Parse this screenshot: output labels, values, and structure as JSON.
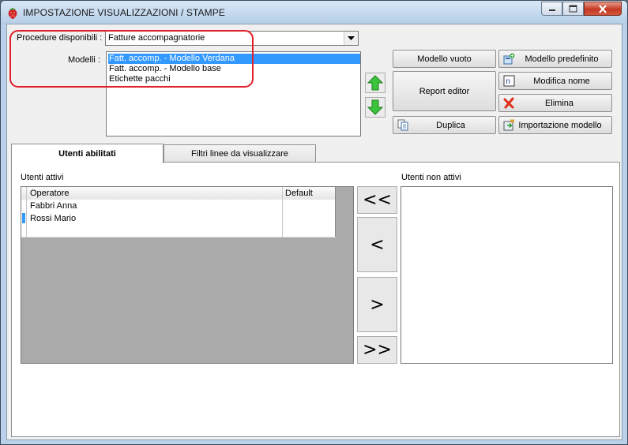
{
  "window": {
    "title": "IMPOSTAZIONE VISUALIZZAZIONI / STAMPE",
    "app_icon": "strawberry-icon",
    "controls": [
      "minimize",
      "maximize",
      "close"
    ]
  },
  "procedure": {
    "label": "Procedure disponibili :",
    "selected": "Fatture accompagnatorie"
  },
  "modelli": {
    "label": "Modelli :",
    "items": [
      {
        "label": "Fatt. accomp. - Modello Verdana",
        "selected": true
      },
      {
        "label": "Fatt. accomp. - Modello base",
        "selected": false
      },
      {
        "label": "Etichette pacchi",
        "selected": false
      }
    ]
  },
  "buttons": {
    "modello_vuoto": "Modello vuoto",
    "modello_predefinito": "Modello predefinito",
    "report_editor": "Report editor",
    "modifica_nome": "Modifica nome",
    "elimina": "Elimina",
    "duplica": "Duplica",
    "importazione_modello": "Importazione modello"
  },
  "tabs": [
    {
      "label": "Utenti abilitati",
      "active": true
    },
    {
      "label": "Filtri linee da visualizzare",
      "active": false
    }
  ],
  "utenti_attivi": {
    "label": "Utenti attivi",
    "columns": [
      "Operatore",
      "Default"
    ],
    "rows": [
      {
        "operatore": "Fabbri Anna",
        "default": ""
      },
      {
        "operatore": "Rossi Mario",
        "default": ""
      }
    ]
  },
  "utenti_non_attivi": {
    "label": "Utenti non attivi",
    "rows": []
  },
  "move_buttons": {
    "all_left": "<<",
    "one_left": "<",
    "one_right": ">",
    "all_right": ">>"
  },
  "colors": {
    "selection": "#3399ff",
    "highlight_border": "#e0202a",
    "grid_background": "#aaaaaa"
  }
}
